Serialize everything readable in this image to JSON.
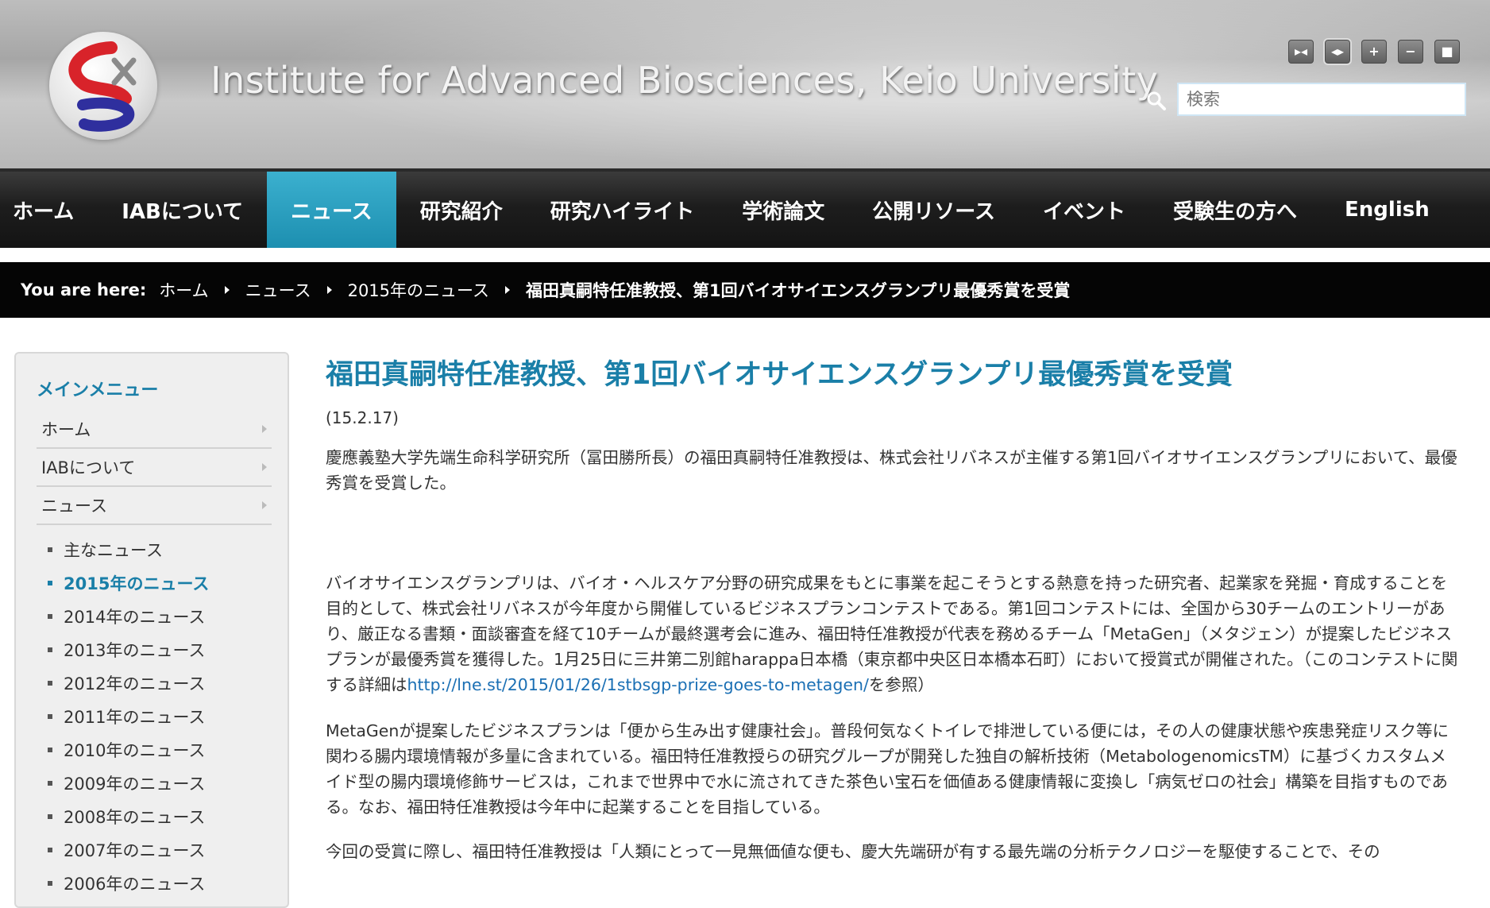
{
  "header": {
    "site_title": "Institute for Advanced Biosciences, Keio University",
    "tool_buttons": [
      "▸◂",
      "◂▸",
      "+",
      "−",
      "■"
    ],
    "search_placeholder": "検索"
  },
  "nav": {
    "items": [
      "ホーム",
      "IABについて",
      "ニュース",
      "研究紹介",
      "研究ハイライト",
      "学術論文",
      "公開リソース",
      "イベント",
      "受験生の方へ",
      "English"
    ],
    "active_index": 2
  },
  "breadcrumb": {
    "label": "You are here:",
    "items": [
      "ホーム",
      "ニュース",
      "2015年のニュース"
    ],
    "current": "福田真嗣特任准教授、第1回バイオサイエンスグランプリ最優秀賞を受賞"
  },
  "sidebar": {
    "title": "メインメニュー",
    "items": [
      "ホーム",
      "IABについて",
      "ニュース"
    ],
    "sub_items": [
      "主なニュース",
      "2015年のニュース",
      "2014年のニュース",
      "2013年のニュース",
      "2012年のニュース",
      "2011年のニュース",
      "2010年のニュース",
      "2009年のニュース",
      "2008年のニュース",
      "2007年のニュース",
      "2006年のニュース"
    ],
    "active_sub_index": 1
  },
  "article": {
    "title": "福田真嗣特任准教授、第1回バイオサイエンスグランプリ最優秀賞を受賞",
    "date": "(15.2.17)",
    "p1": "慶應義塾大学先端生命科学研究所（冨田勝所長）の福田真嗣特任准教授は、株式会社リバネスが主催する第1回バイオサイエンスグランプリにおいて、最優秀賞を受賞した。",
    "p2_before": "バイオサイエンスグランプリは、バイオ・ヘルスケア分野の研究成果をもとに事業を起こそうとする熱意を持った研究者、起業家を発掘・育成することを目的として、株式会社リバネスが今年度から開催しているビジネスプランコンテストである。第1回コンテストには、全国から30チームのエントリーがあり、厳正なる書類・面談審査を経て10チームが最終選考会に進み、福田特任准教授が代表を務めるチーム「MetaGen」（メタジェン）が提案したビジネスプランが最優秀賞を獲得した。1月25日に三井第二別館harappa日本橋（東京都中央区日本橋本石町）において授賞式が開催された。（このコンテストに関する詳細は",
    "p2_link": "http://lne.st/2015/01/26/1stbsgp-prize-goes-to-metagen/",
    "p2_after": "を参照）",
    "p3": "MetaGenが提案したビジネスプランは「便から生み出す健康社会」。普段何気なくトイレで排泄している便には，その人の健康状態や疾患発症リスク等に関わる腸内環境情報が多量に含まれている。福田特任准教授らの研究グループが開発した独自の解析技術（MetabologenomicsTM）に基づくカスタムメイド型の腸内環境修飾サービスは，これまで世界中で水に流されてきた茶色い宝石を価値ある健康情報に変換し「病気ゼロの社会」構築を目指すものである。なお、福田特任准教授は今年中に起業することを目指している。",
    "p4": "今回の受賞に際し、福田特任准教授は「人類にとって一見無価値な便も、慶大先端研が有する最先端の分析テクノロジーを駆使することで、その"
  }
}
